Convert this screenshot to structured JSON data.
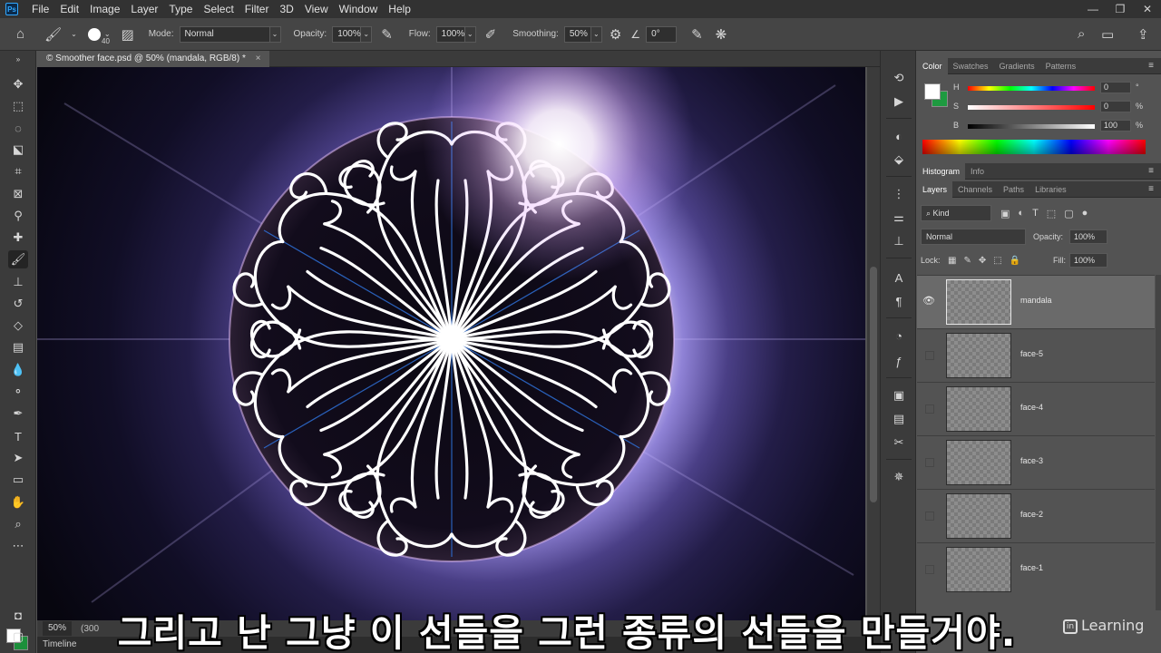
{
  "app": {
    "logo": "Ps",
    "menu": [
      "File",
      "Edit",
      "Image",
      "Layer",
      "Type",
      "Select",
      "Filter",
      "3D",
      "View",
      "Window",
      "Help"
    ],
    "window_controls": [
      "—",
      "❐",
      "✕"
    ]
  },
  "options_bar": {
    "brush_size": "40",
    "mode_label": "Mode:",
    "mode_value": "Normal",
    "opacity_label": "Opacity:",
    "opacity_value": "100%",
    "flow_label": "Flow:",
    "flow_value": "100%",
    "smoothing_label": "Smoothing:",
    "smoothing_value": "50%",
    "angle_value": "0°"
  },
  "document": {
    "tab_title": "© Smoother face.psd @ 50% (mandala, RGB/8) *",
    "zoom": "50%",
    "doc_info": "(300",
    "timeline_label": "Timeline"
  },
  "color_panel": {
    "tabs": [
      "Color",
      "Swatches",
      "Gradients",
      "Patterns"
    ],
    "active_tab": "Color",
    "sliders": [
      {
        "label": "H",
        "value": "0",
        "unit": "°"
      },
      {
        "label": "S",
        "value": "0",
        "unit": "%"
      },
      {
        "label": "B",
        "value": "100",
        "unit": "%"
      }
    ],
    "fg_color": "#ffffff",
    "bg_color": "#1e9a40"
  },
  "histogram_panel": {
    "tabs": [
      "Histogram",
      "Info"
    ]
  },
  "layers_panel": {
    "tabs": [
      "Layers",
      "Channels",
      "Paths",
      "Libraries"
    ],
    "kind_label": "Kind",
    "blend_mode": "Normal",
    "opacity_label": "Opacity:",
    "opacity_value": "100%",
    "lock_label": "Lock:",
    "fill_label": "Fill:",
    "fill_value": "100%",
    "layers": [
      {
        "name": "mandala",
        "visible": true,
        "selected": true
      },
      {
        "name": "face-5",
        "visible": false,
        "selected": false
      },
      {
        "name": "face-4",
        "visible": false,
        "selected": false
      },
      {
        "name": "face-3",
        "visible": false,
        "selected": false
      },
      {
        "name": "face-2",
        "visible": false,
        "selected": false
      },
      {
        "name": "face-1",
        "visible": false,
        "selected": false
      }
    ]
  },
  "subtitle": "그리고 난 그냥 이 선들을 그런 종류의 선들을 만들거야.",
  "watermark": "Learning",
  "watermark_logo": "in"
}
